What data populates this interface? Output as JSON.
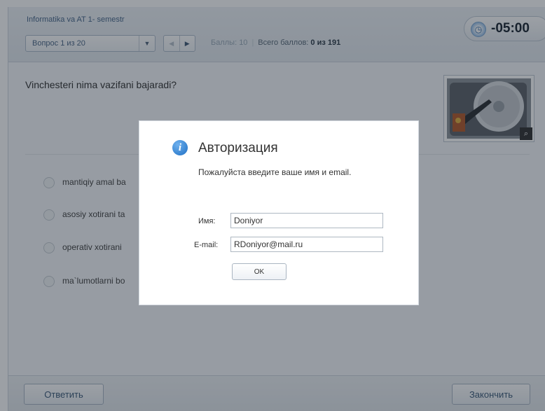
{
  "header": {
    "app_title": "Informatika va AT 1- semestr",
    "question_select": "Вопрос 1 из 20",
    "score_label": "Баллы: 10",
    "total_label": "Всего баллов:",
    "total_value": "0 из 191",
    "timer": "-05:00"
  },
  "question": {
    "text": "Vinchesteri nima vazifani bajaradi?",
    "options": [
      {
        "text": "mantiqiy amal ba"
      },
      {
        "text": "asosiy xotirani ta"
      },
      {
        "text": "operativ xotirani"
      },
      {
        "text": "ma`lumotlarni bo"
      }
    ]
  },
  "footer": {
    "answer_label": "Ответить",
    "finish_label": "Закончить"
  },
  "dialog": {
    "title": "Авторизация",
    "message": "Пожалуйста введите ваше имя и email.",
    "name_label": "Имя:",
    "name_value": "Doniyor",
    "email_label": "E-mail:",
    "email_value": "RDoniyor@mail.ru",
    "ok_label": "OK"
  },
  "colors": {
    "accent": "#1e6fc4",
    "header_text": "#4a6a8c"
  }
}
